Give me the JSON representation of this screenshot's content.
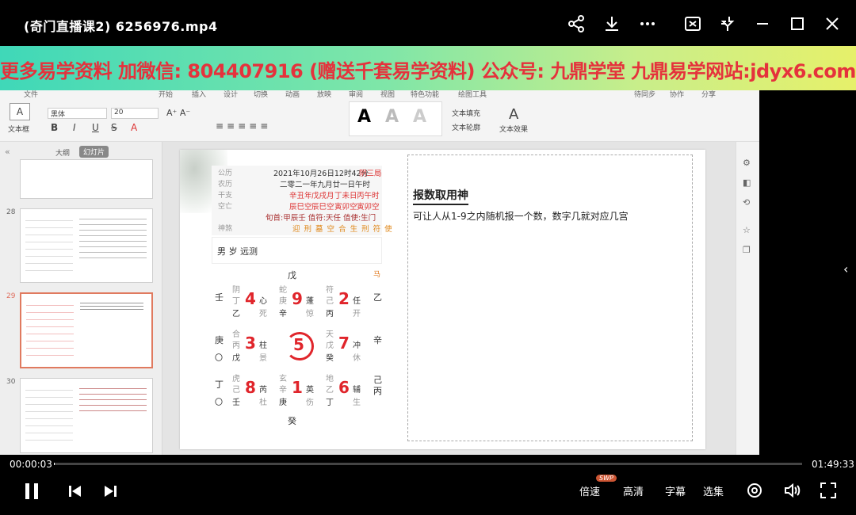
{
  "player": {
    "title": "(奇门直播课2)   6256976.mp4",
    "current_time": "00:00:03",
    "total_time": "01:49:33",
    "progress": 0.0005,
    "speed_label": "倍速",
    "speed_badge": "SWP",
    "quality_label": "高清",
    "subtitle_label": "字幕",
    "episodes_label": "选集"
  },
  "banner": {
    "text": "更多易学资料 加微信: 804407916 (赠送千套易学资料) 公众号: 九鼎学堂    九鼎易学网站:jdyx6.com"
  },
  "ppt": {
    "tabs": [
      "文件",
      "开始",
      "插入",
      "设计",
      "切换",
      "动画",
      "放映",
      "审阅",
      "视图",
      "特色功能",
      "绘图工具"
    ],
    "right_items": [
      "待同步",
      "协作",
      "分享"
    ],
    "font_name": "黑体",
    "font_size": "20",
    "textbox_label": "文本框",
    "fill_label": "文本填充",
    "outline_label": "文本轮廓",
    "effect_label": "文本效果",
    "pane_tabs": [
      "大纲",
      "幻灯片"
    ],
    "thumb_numbers": [
      "28",
      "29",
      "30"
    ]
  },
  "slide": {
    "pan": {
      "labels": [
        "公历",
        "农历",
        "干支",
        "空亡",
        "",
        "神煞"
      ],
      "gongli": "2021年10月26日12时42分",
      "gongli_ju": "阴三局",
      "nongli": "二零二一年九月廿一日午时",
      "ganzhi": [
        "辛丑年",
        "戊戌月",
        "丁未日",
        "丙午时"
      ],
      "kongwang": [
        "辰巳空",
        "辰巳空",
        "寅卯空",
        "寅卯空"
      ],
      "xun": "旬首:甲辰壬  值符:天任  值使:生门",
      "shensha": "迎 刑 墓 空 合 生 刑 符 使"
    },
    "question": "男 岁 远测",
    "grid": {
      "top": "戊",
      "bottom": "癸",
      "left": [
        "壬",
        "庚",
        "〇",
        "丁",
        "〇"
      ],
      "right": [
        "乙",
        "辛",
        "己",
        "丙"
      ],
      "top_right": "马",
      "palaces": [
        {
          "num": "4",
          "god": "阴",
          "star": "心",
          "stem": "丁",
          "gan": "乙",
          "door": "死"
        },
        {
          "num": "9",
          "god": "蛇",
          "star": "蓬",
          "stem": "庚",
          "gan": "辛",
          "door": "惊"
        },
        {
          "num": "2",
          "god": "符",
          "star": "任",
          "stem": "己",
          "gan": "丙",
          "door": "开"
        },
        {
          "num": "3",
          "god": "合",
          "star": "柱",
          "stem": "丙",
          "gan": "戊",
          "door": "景"
        },
        {
          "num": "5",
          "god": "",
          "star": "",
          "stem": "",
          "gan": "",
          "door": ""
        },
        {
          "num": "7",
          "god": "天",
          "star": "冲",
          "stem": "戊",
          "gan": "癸",
          "door": "休"
        },
        {
          "num": "8",
          "god": "虎",
          "star": "芮",
          "stem": "己",
          "gan": "壬",
          "door": "杜"
        },
        {
          "num": "1",
          "god": "玄",
          "star": "英",
          "stem": "辛",
          "gan": "庚",
          "door": "伤"
        },
        {
          "num": "6",
          "god": "地",
          "star": "辅",
          "stem": "乙",
          "gan": "丁",
          "door": "生"
        }
      ]
    },
    "heading": "报数取用神",
    "body": "可让人从1-9之内随机报一个数，数字几就对应几宫"
  }
}
